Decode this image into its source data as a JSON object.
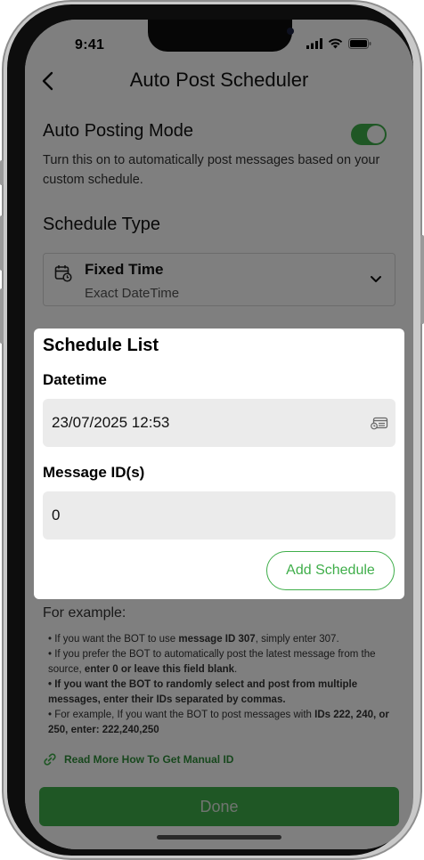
{
  "status_bar": {
    "time": "9:41"
  },
  "header": {
    "title": "Auto Post Scheduler"
  },
  "auto_posting": {
    "title": "Auto Posting Mode",
    "description": "Turn this on to automatically post messages based on your custom schedule.",
    "enabled": true
  },
  "schedule_type": {
    "title": "Schedule Type",
    "selected_name": "Fixed Time",
    "selected_sub": "Exact DateTime"
  },
  "modal": {
    "title": "Schedule List",
    "datetime_label": "Datetime",
    "datetime_value": "23/07/2025 12:53",
    "message_ids_label": "Message ID(s)",
    "message_ids_value": "0",
    "add_button": "Add Schedule"
  },
  "examples": {
    "title": "For example:",
    "line1_pre": "• If you want the BOT to use ",
    "line1_bold": "message ID 307",
    "line1_post": ", simply enter 307.",
    "line2_pre": "• If you prefer the BOT to automatically post the latest message from the source, ",
    "line2_bold": "enter 0 or leave this field blank",
    "line2_post": ".",
    "line3_bold": "• If you want the BOT to randomly select and post from multiple messages, enter their IDs separated by commas.",
    "line4_pre": "• For example, If you want the BOT to post messages with ",
    "line4_bold": "IDs 222, 240, or 250, enter: 222,240,250"
  },
  "read_more": "Read More How To Get Manual ID",
  "done_button": "Done",
  "colors": {
    "accent": "#3fae4a",
    "overlay": "rgba(0,0,0,0.5)"
  },
  "icons": [
    "back-arrow-icon",
    "calendar-clock-icon",
    "chevron-down-icon",
    "date-picker-icon",
    "link-icon",
    "signal-icon",
    "wifi-icon",
    "battery-icon"
  ]
}
